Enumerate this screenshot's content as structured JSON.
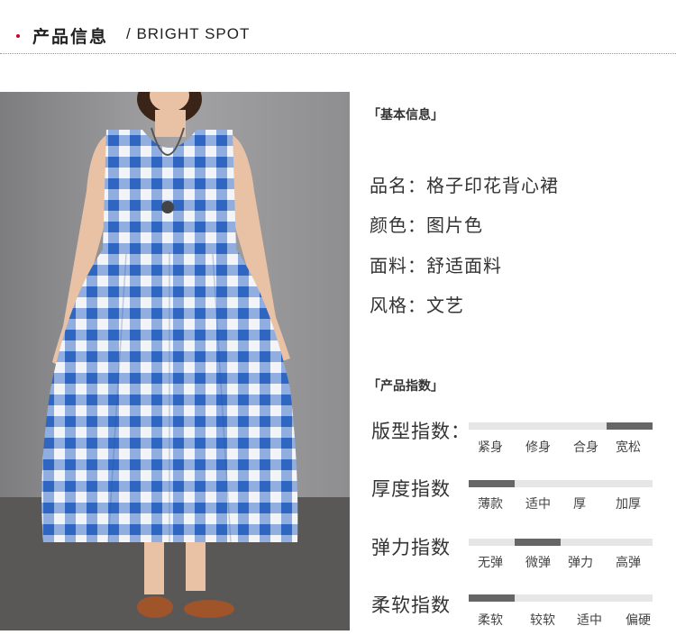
{
  "header": {
    "title_cn": "产品信息",
    "title_en": "/ BRIGHT SPOT",
    "accent_color": "#d0021b"
  },
  "photo": {
    "alt": "model wearing blue gingham sleeveless dress"
  },
  "basic_info": {
    "label": "「基本信息」",
    "lines": [
      "品名：格子印花背心裙",
      "颜色：图片色",
      "面料：舒适面料",
      "风格：文艺"
    ]
  },
  "product_index": {
    "label": "「产品指数」",
    "rows": [
      {
        "title": "版型指数：",
        "options": [
          "紧身",
          "修身",
          "合身",
          "宽松"
        ],
        "selected_index": 3
      },
      {
        "title": "厚度指数",
        "options": [
          "薄款",
          "适中",
          "厚",
          "加厚"
        ],
        "selected_index": 0
      },
      {
        "title": "弹力指数",
        "options": [
          "无弹",
          "微弹",
          "弹力",
          "高弹"
        ],
        "selected_index": 1
      },
      {
        "title": "柔软指数",
        "options": [
          "柔软",
          "较软",
          "适中",
          "偏硬"
        ],
        "selected_index": 0
      }
    ]
  }
}
